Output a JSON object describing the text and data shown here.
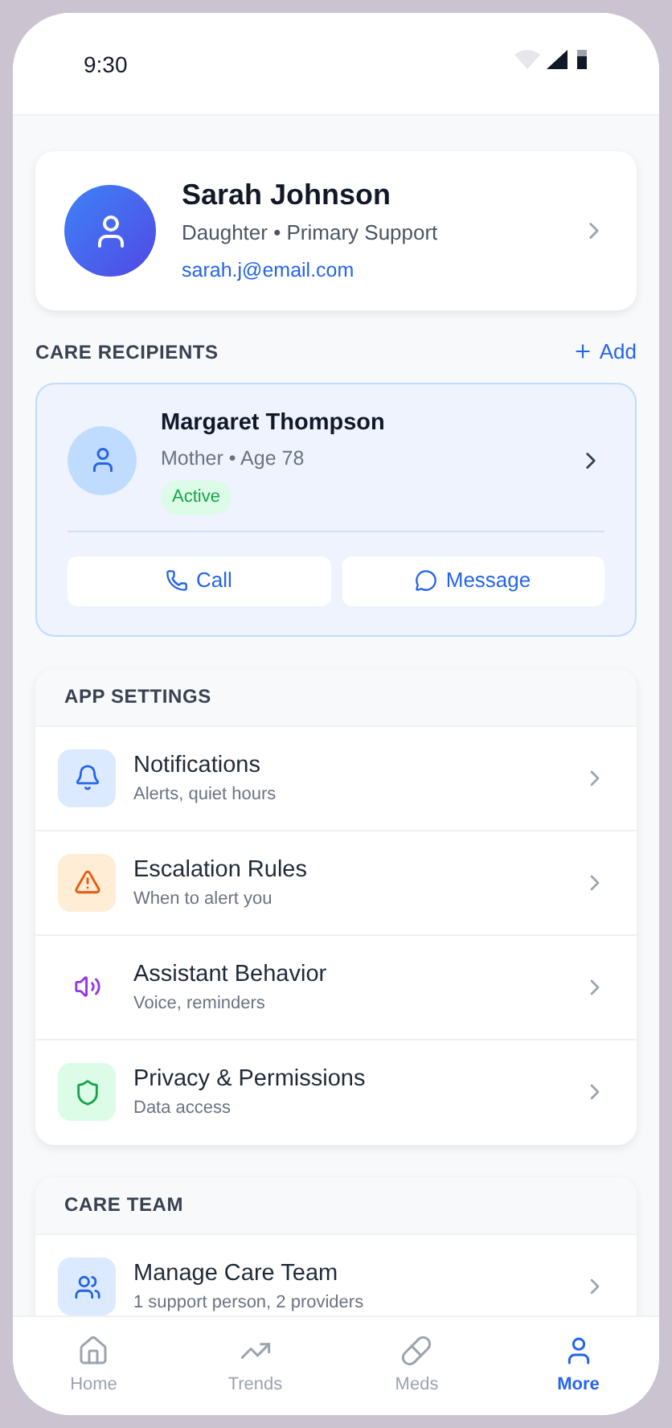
{
  "status_bar": {
    "time": "9:30"
  },
  "profile": {
    "name": "Sarah Johnson",
    "role": "Daughter • Primary Support",
    "email": "sarah.j@email.com"
  },
  "care_recipients": {
    "title": "CARE RECIPIENTS",
    "add_label": "Add",
    "items": [
      {
        "name": "Margaret Thompson",
        "details": "Mother • Age 78",
        "status": "Active",
        "actions": [
          {
            "label": "Call"
          },
          {
            "label": "Message"
          }
        ]
      }
    ]
  },
  "sections": [
    {
      "title": "APP SETTINGS",
      "items": [
        {
          "title": "Notifications",
          "subtitle": "Alerts, quiet hours"
        },
        {
          "title": "Escalation Rules",
          "subtitle": "When to alert you"
        },
        {
          "title": "Assistant Behavior",
          "subtitle": "Voice, reminders"
        },
        {
          "title": "Privacy & Permissions",
          "subtitle": "Data access"
        }
      ]
    },
    {
      "title": "CARE TEAM",
      "items": [
        {
          "title": "Manage Care Team",
          "subtitle": "1 support person, 2 providers"
        }
      ]
    }
  ],
  "bottom_nav": [
    {
      "label": "Home",
      "selected": false
    },
    {
      "label": "Trends",
      "selected": false
    },
    {
      "label": "Meds",
      "selected": false
    },
    {
      "label": "More",
      "selected": true
    }
  ]
}
